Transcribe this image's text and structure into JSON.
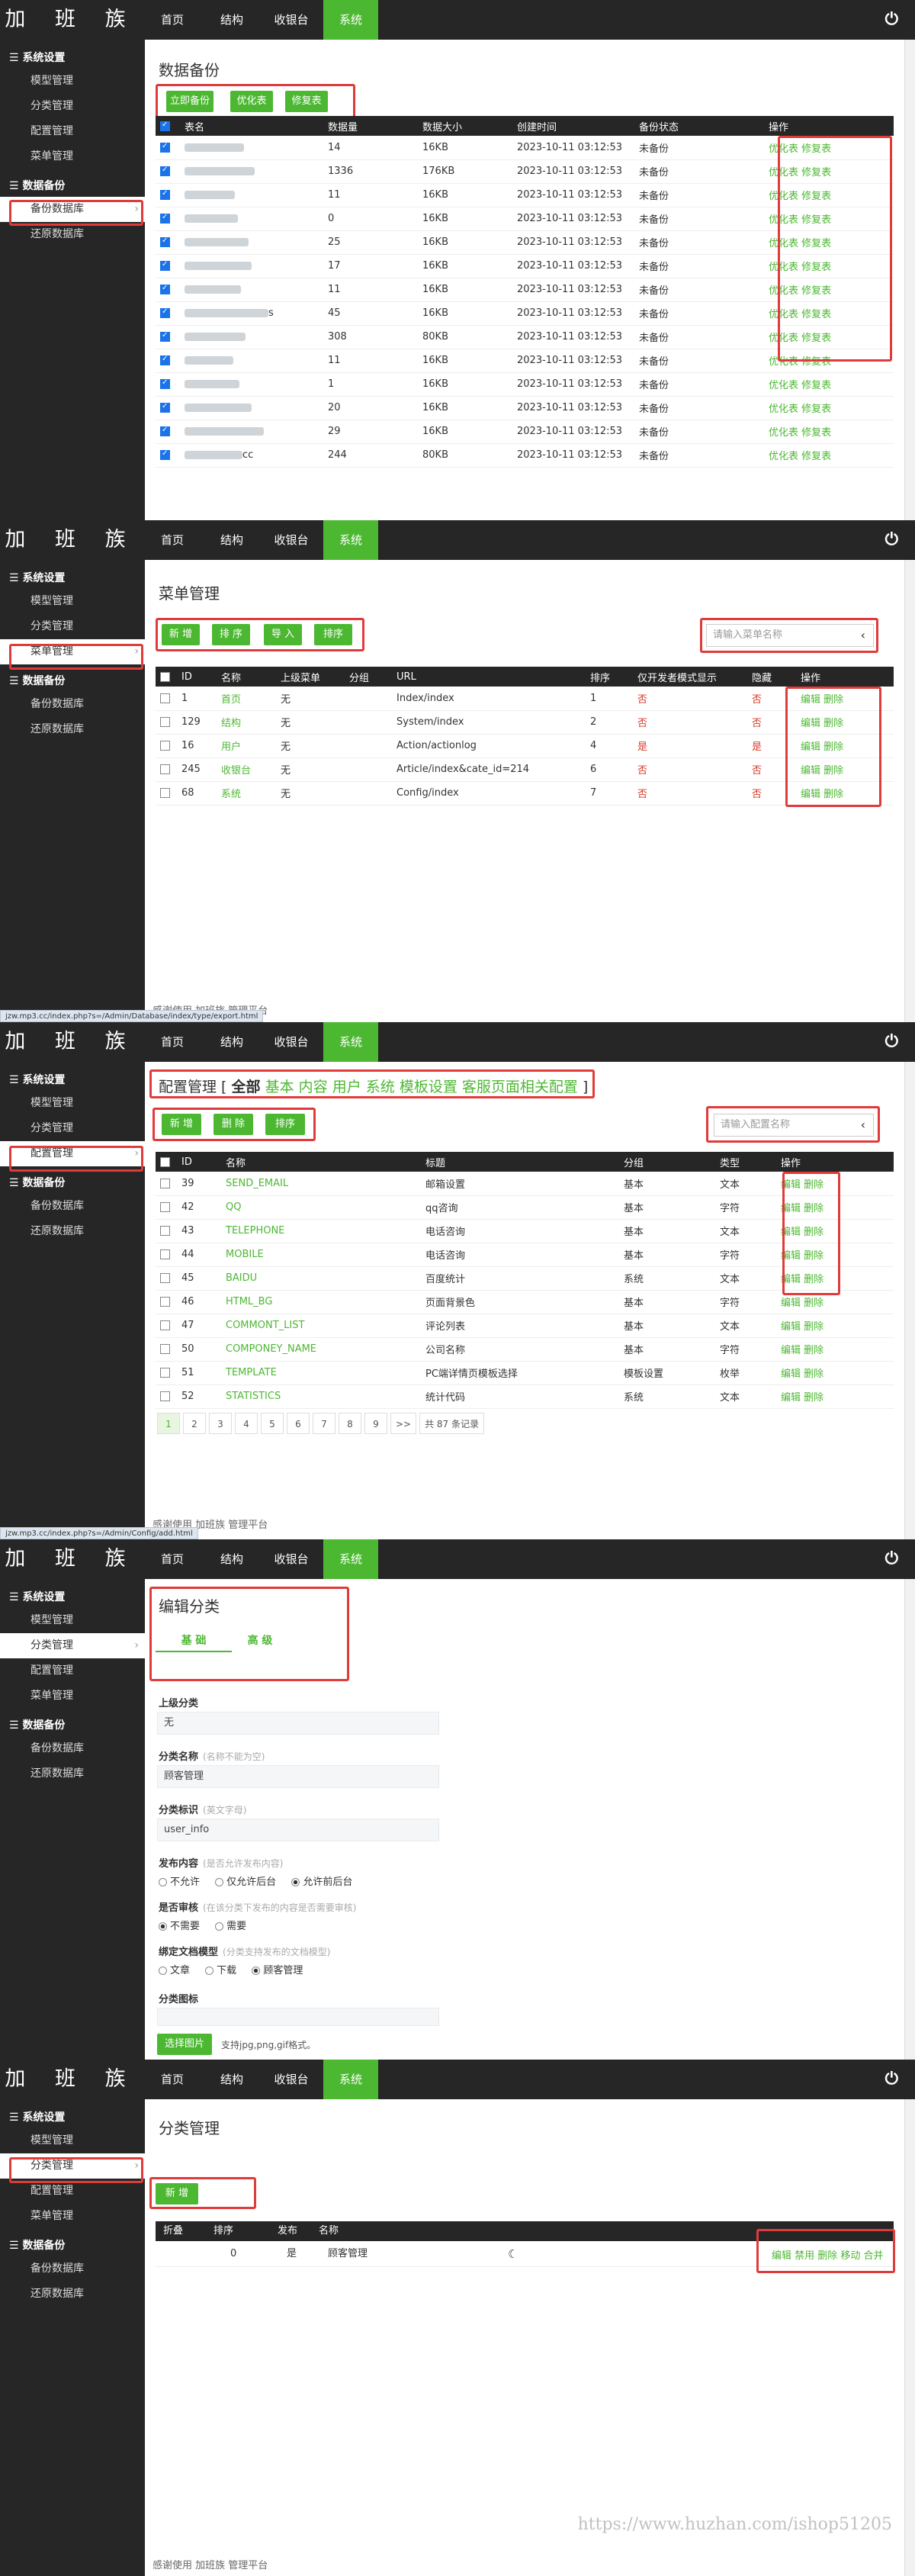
{
  "brand": "加 班 族",
  "nav": [
    "首页",
    "结构",
    "收银台",
    "系统"
  ],
  "sidebar": {
    "group_system": "系统设置",
    "items_system": [
      "模型管理",
      "分类管理",
      "配置管理",
      "菜单管理"
    ],
    "group_backup": "数据备份",
    "items_backup": [
      "备份数据库",
      "还原数据库"
    ]
  },
  "p1": {
    "title": "数据备份",
    "buttons": [
      "立即备份",
      "优化表",
      "修复表"
    ],
    "headers": [
      "表名",
      "数据量",
      "数据大小",
      "创建时间",
      "备份状态",
      "操作"
    ],
    "rows": [
      {
        "count": "14",
        "size": "16KB",
        "time": "2023-10-11 03:12:53",
        "status": "未备份"
      },
      {
        "count": "1336",
        "size": "176KB",
        "time": "2023-10-11 03:12:53",
        "status": "未备份"
      },
      {
        "count": "11",
        "size": "16KB",
        "time": "2023-10-11 03:12:53",
        "status": "未备份"
      },
      {
        "count": "0",
        "size": "16KB",
        "time": "2023-10-11 03:12:53",
        "status": "未备份"
      },
      {
        "count": "25",
        "size": "16KB",
        "time": "2023-10-11 03:12:53",
        "status": "未备份"
      },
      {
        "count": "17",
        "size": "16KB",
        "time": "2023-10-11 03:12:53",
        "status": "未备份"
      },
      {
        "count": "11",
        "size": "16KB",
        "time": "2023-10-11 03:12:53",
        "status": "未备份"
      },
      {
        "count": "45",
        "size": "16KB",
        "time": "2023-10-11 03:12:53",
        "status": "未备份"
      },
      {
        "count": "308",
        "size": "80KB",
        "time": "2023-10-11 03:12:53",
        "status": "未备份"
      },
      {
        "count": "11",
        "size": "16KB",
        "time": "2023-10-11 03:12:53",
        "status": "未备份"
      },
      {
        "count": "1",
        "size": "16KB",
        "time": "2023-10-11 03:12:53",
        "status": "未备份"
      },
      {
        "count": "20",
        "size": "16KB",
        "time": "2023-10-11 03:12:53",
        "status": "未备份"
      },
      {
        "count": "29",
        "size": "16KB",
        "time": "2023-10-11 03:12:53",
        "status": "未备份"
      },
      {
        "count": "244",
        "size": "80KB",
        "time": "2023-10-11 03:12:53",
        "status": "未备份"
      }
    ],
    "action_optimize": "优化表",
    "action_repair": "修复表",
    "partial_names": [
      "",
      "",
      "",
      "",
      "",
      "",
      "",
      "s",
      "",
      "",
      "",
      "",
      "",
      "cc"
    ]
  },
  "p2": {
    "title": "菜单管理",
    "buttons": [
      "新 增",
      "排 序",
      "导 入",
      "排序"
    ],
    "search_placeholder": "请输入菜单名称",
    "headers": [
      "ID",
      "名称",
      "上级菜单",
      "分组",
      "URL",
      "排序",
      "仅开发者模式显示",
      "隐藏",
      "操作"
    ],
    "rows": [
      {
        "id": "1",
        "name": "首页",
        "parent": "无",
        "group": "",
        "url": "Index/index",
        "sort": "1",
        "dev": "否",
        "hide": "否"
      },
      {
        "id": "129",
        "name": "结构",
        "parent": "无",
        "group": "",
        "url": "System/index",
        "sort": "2",
        "dev": "否",
        "hide": "否"
      },
      {
        "id": "16",
        "name": "用户",
        "parent": "无",
        "group": "",
        "url": "Action/actionlog",
        "sort": "4",
        "dev": "是",
        "hide": "是"
      },
      {
        "id": "245",
        "name": "收银台",
        "parent": "无",
        "group": "",
        "url": "Article/index&cate_id=214",
        "sort": "6",
        "dev": "否",
        "hide": "否"
      },
      {
        "id": "68",
        "name": "系统",
        "parent": "无",
        "group": "",
        "url": "Config/index",
        "sort": "7",
        "dev": "否",
        "hide": "否"
      }
    ],
    "action_edit": "编辑",
    "action_delete": "删除",
    "footer": "感谢使用 加班族 管理平台",
    "status_url": "jzw.mp3.cc/index.php?s=/Admin/Database/index/type/export.html"
  },
  "p3": {
    "title_main": "配置管理 [ ",
    "title_tabs": [
      "全部",
      "基本",
      "内容",
      "用户",
      "系统",
      "模板设置",
      "客服页面相关配置"
    ],
    "title_end": " ]",
    "buttons": [
      "新 增",
      "删 除",
      "排序"
    ],
    "search_placeholder": "请输入配置名称",
    "headers": [
      "ID",
      "名称",
      "标题",
      "分组",
      "类型",
      "操作"
    ],
    "rows": [
      {
        "id": "39",
        "name": "SEND_EMAIL",
        "title": "邮箱设置",
        "group": "基本",
        "type": "文本"
      },
      {
        "id": "42",
        "name": "QQ",
        "title": "qq咨询",
        "group": "基本",
        "type": "字符"
      },
      {
        "id": "43",
        "name": "TELEPHONE",
        "title": "电话咨询",
        "group": "基本",
        "type": "文本"
      },
      {
        "id": "44",
        "name": "MOBILE",
        "title": "电话咨询",
        "group": "基本",
        "type": "字符"
      },
      {
        "id": "45",
        "name": "BAIDU",
        "title": "百度统计",
        "group": "系统",
        "type": "文本"
      },
      {
        "id": "46",
        "name": "HTML_BG",
        "title": "页面背景色",
        "group": "基本",
        "type": "字符"
      },
      {
        "id": "47",
        "name": "COMMONT_LIST",
        "title": "评论列表",
        "group": "基本",
        "type": "文本"
      },
      {
        "id": "50",
        "name": "COMPONEY_NAME",
        "title": "公司名称",
        "group": "基本",
        "type": "字符"
      },
      {
        "id": "51",
        "name": "TEMPLATE",
        "title": "PC端详情页模板选择",
        "group": "模板设置",
        "type": "枚举"
      },
      {
        "id": "52",
        "name": "STATISTICS",
        "title": "统计代码",
        "group": "系统",
        "type": "文本"
      }
    ],
    "pager": [
      "1",
      "2",
      "3",
      "4",
      "5",
      "6",
      "7",
      "8",
      "9",
      ">>",
      "共 87 条记录"
    ],
    "footer": "感谢使用 加班族 管理平台",
    "status_url": "jzw.mp3.cc/index.php?s=/Admin/Config/add.html"
  },
  "p4": {
    "title": "编辑分类",
    "tabs": [
      "基 础",
      "高 级"
    ],
    "parent_label": "上级分类",
    "parent_value": "无",
    "name_label": "分类名称",
    "name_hint": "(名称不能为空)",
    "name_value": "顾客管理",
    "ident_label": "分类标识",
    "ident_hint": "(英文字母)",
    "ident_value": "user_info",
    "publish_label": "发布内容",
    "publish_hint": "(是否允许发布内容)",
    "publish_opts": [
      "不允许",
      "仅允许后台",
      "允许前后台"
    ],
    "review_label": "是否审核",
    "review_hint": "(在该分类下发布的内容是否需要审核)",
    "review_opts": [
      "不需要",
      "需要"
    ],
    "model_label": "绑定文档模型",
    "model_hint": "(分类支持发布的文档模型)",
    "model_opts": [
      "文章",
      "下载",
      "顾客管理"
    ],
    "icon_label": "分类图标",
    "upload_btn": "选择图片",
    "upload_hint": "支持jpg,png,gif格式。"
  },
  "p5": {
    "title": "分类管理",
    "add_btn": "新 增",
    "headers": [
      "折叠",
      "排序",
      "发布",
      "名称"
    ],
    "row": {
      "sort": "0",
      "publish": "是",
      "name": "顾客管理"
    },
    "actions": "编辑 禁用 删除 移动 合并",
    "footer": "感谢使用 加班族 管理平台",
    "watermark": "https://www.huzhan.com/ishop51205"
  }
}
